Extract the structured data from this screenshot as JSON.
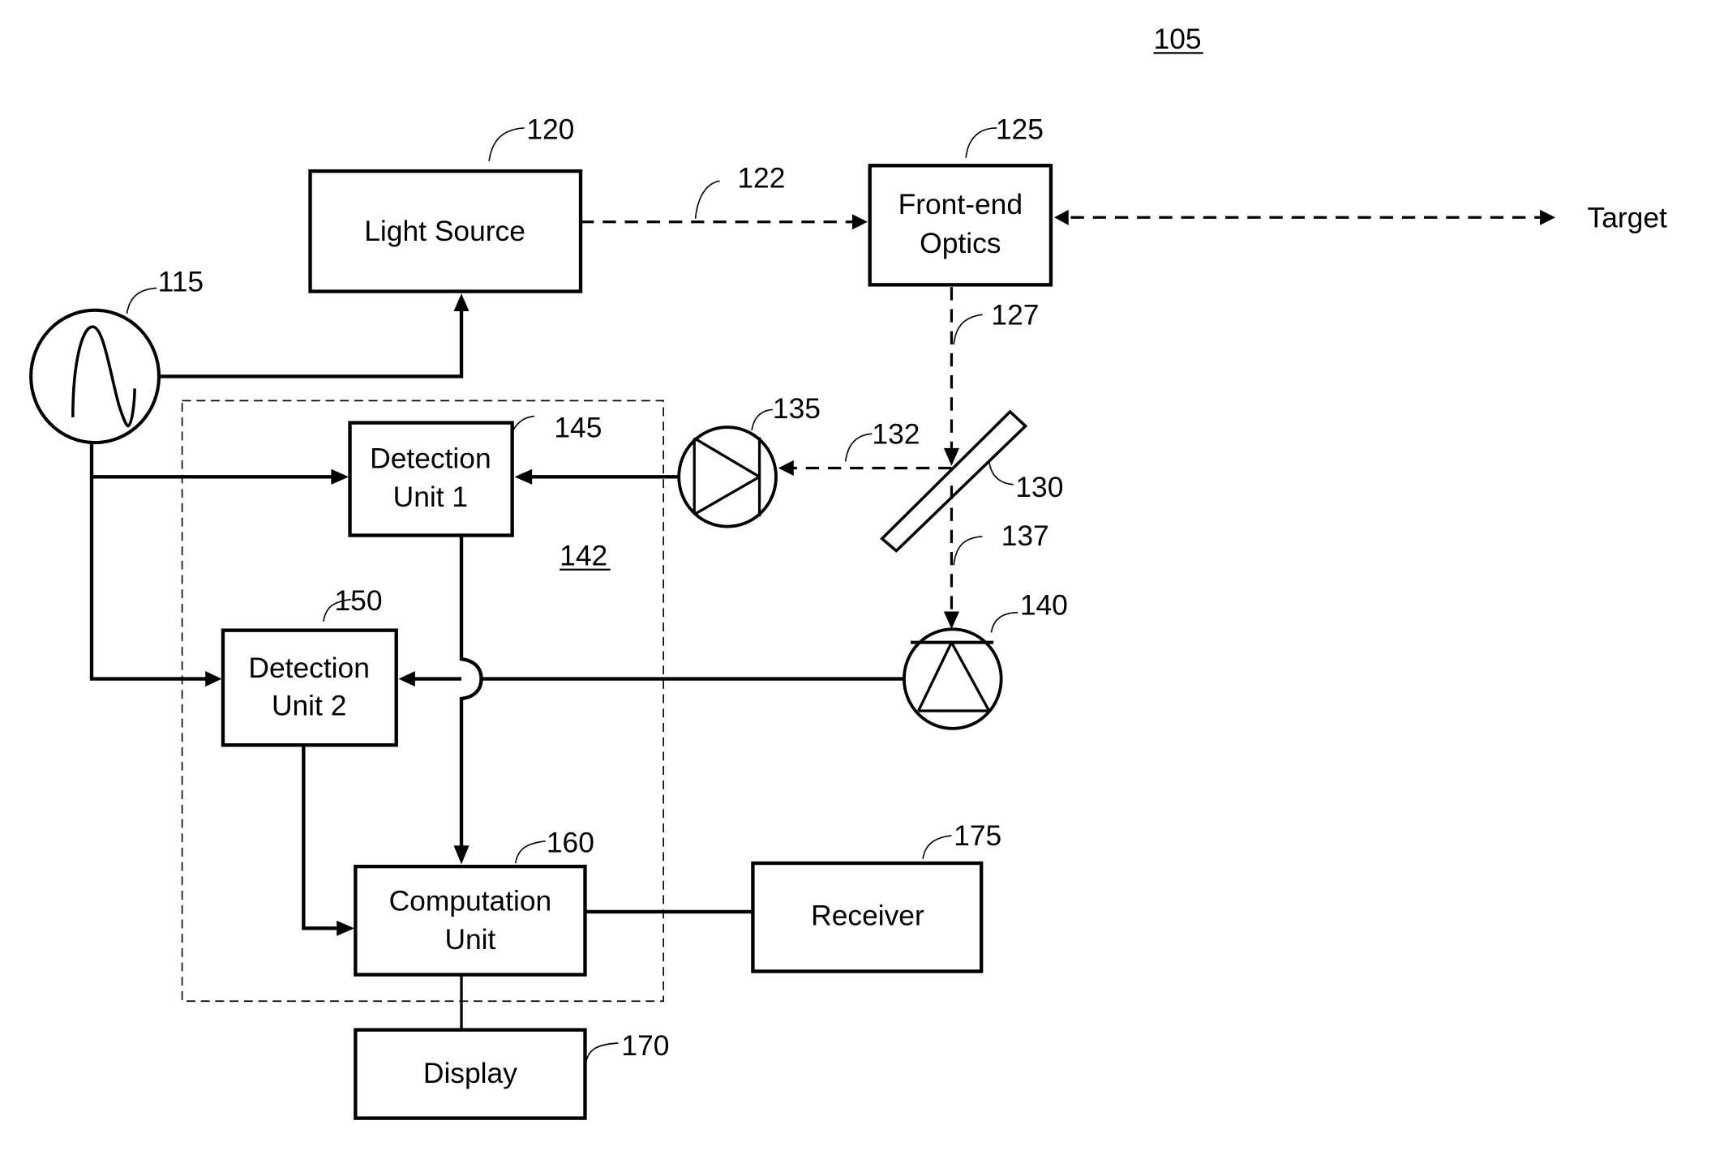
{
  "figure": {
    "ref": "105",
    "group_ref": "142"
  },
  "blocks": {
    "light_source": {
      "ref": "120",
      "lines": [
        "Light Source"
      ]
    },
    "front_end_optics": {
      "ref": "125",
      "lines": [
        "Front-end",
        "Optics"
      ]
    },
    "detection_unit_1": {
      "ref": "145",
      "lines": [
        "Detection",
        "Unit 1"
      ]
    },
    "detection_unit_2": {
      "ref": "150",
      "lines": [
        "Detection",
        "Unit 2"
      ]
    },
    "computation_unit": {
      "ref": "160",
      "lines": [
        "Computation",
        "Unit"
      ]
    },
    "receiver": {
      "ref": "175",
      "lines": [
        "Receiver"
      ]
    },
    "display": {
      "ref": "170",
      "lines": [
        "Display"
      ]
    }
  },
  "components": {
    "oscillator": {
      "ref": "115",
      "icon": "sine-wave-source-icon"
    },
    "photodetector_1": {
      "ref": "135",
      "icon": "photodiode-icon"
    },
    "photodetector_2": {
      "ref": "140",
      "icon": "photodiode-icon"
    },
    "beam_splitter": {
      "ref": "130",
      "icon": "beam-splitter-icon"
    }
  },
  "beams": {
    "source_to_optics": "122",
    "optics_to_splitter": "127",
    "splitter_to_pd1": "132",
    "splitter_to_pd2": "137"
  },
  "target_label": "Target"
}
